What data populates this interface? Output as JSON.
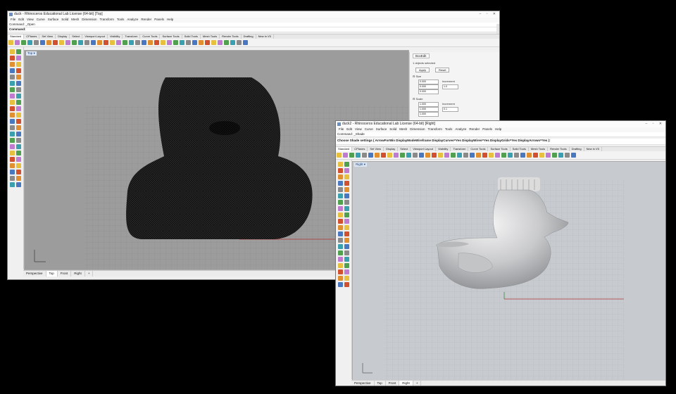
{
  "window1": {
    "title": "duck - Rhinoceros Educational Lab License (64-bit)",
    "title_tag": "Top",
    "menu": [
      "File",
      "Edit",
      "View",
      "Curve",
      "Surface",
      "Solid",
      "Mesh",
      "Dimension",
      "Transform",
      "Tools",
      "Analyze",
      "Render",
      "Panels",
      "Help"
    ],
    "command_history": "Command: _Open",
    "command_prompt": "Command:",
    "tabs": [
      "Standard",
      "CPlanes",
      "Set View",
      "Display",
      "Select",
      "Viewport Layout",
      "Visibility",
      "Transform",
      "Curve Tools",
      "Surface Tools",
      "Solid Tools",
      "Mesh Tools",
      "Render Tools",
      "Drafting",
      "New in V5"
    ],
    "active_tab": "Standard",
    "viewport_label": "Top",
    "viewport_tabs": [
      "Perspective",
      "Top",
      "Front",
      "Right"
    ],
    "active_viewport_tab": "Top",
    "panel": {
      "title": "BoxEdit",
      "selection_info": "1 objects selected",
      "apply_label": "Apply",
      "reset_label": "Reset",
      "size_section": "Size",
      "scale_section": "Scale",
      "size_values": [
        "0.000",
        "0.000",
        "0.000"
      ],
      "increment_label": "Increment",
      "increment_value": "1.0",
      "scale_values": [
        "1.000",
        "1.000",
        "1.000"
      ],
      "scale_increment_value": "0.1"
    }
  },
  "window2": {
    "title": "duck2 - Rhinoceros Educational Lab License (64-bit)",
    "title_tag": "Right",
    "menu": [
      "File",
      "Edit",
      "View",
      "Curve",
      "Surface",
      "Solid",
      "Mesh",
      "Dimension",
      "Transform",
      "Tools",
      "Analyze",
      "Render",
      "Panels",
      "Help"
    ],
    "command_history": "Command: _Shade",
    "command_prompt": "Choose Shade settings ( ArrowForWin DisplayModeWireframe DisplayCurves=Yes DisplayWires=Yes DisplayGrids=Yes DisplayArrows=Yes ):",
    "tabs": [
      "Standard",
      "CPlanes",
      "Set View",
      "Display",
      "Select",
      "Viewport Layout",
      "Visibility",
      "Transform",
      "Curve Tools",
      "Surface Tools",
      "Solid Tools",
      "Mesh Tools",
      "Render Tools",
      "Drafting",
      "New in V5"
    ],
    "active_tab": "Standard",
    "viewport_label": "Right",
    "viewport_tabs": [
      "Perspective",
      "Top",
      "Front",
      "Right"
    ],
    "active_viewport_tab": "Right"
  },
  "colors": {
    "desktop": "#000000",
    "viewport_wire": "#9c9c9c",
    "viewport_shaded": "#c7cbd0",
    "axis_red": "#b03030",
    "axis_green": "#3c8a3c",
    "mesh_dark": "#111111",
    "duck_silver": "#d9dadb"
  }
}
